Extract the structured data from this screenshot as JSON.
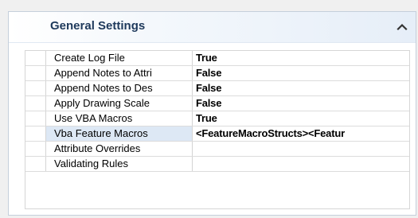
{
  "section": {
    "title": "General Settings",
    "collapse_icon": "chevron-up-icon"
  },
  "colors": {
    "header_text": "#1e395b",
    "header_gradient_end": "#e6eef8",
    "grid_line": "#dcdcdc"
  },
  "properties": [
    {
      "name": "Create Log File",
      "value": "True"
    },
    {
      "name": "Append Notes to Attri",
      "value": "False"
    },
    {
      "name": "Append Notes to Des",
      "value": "False"
    },
    {
      "name": "Apply Drawing Scale",
      "value": "False"
    },
    {
      "name": "Use VBA Macros",
      "value": "True"
    },
    {
      "name": "Vba Feature Macros",
      "value": "<FeatureMacroStructs><Featur"
    },
    {
      "name": "Attribute Overrides",
      "value": ""
    },
    {
      "name": "Validating Rules",
      "value": ""
    }
  ]
}
